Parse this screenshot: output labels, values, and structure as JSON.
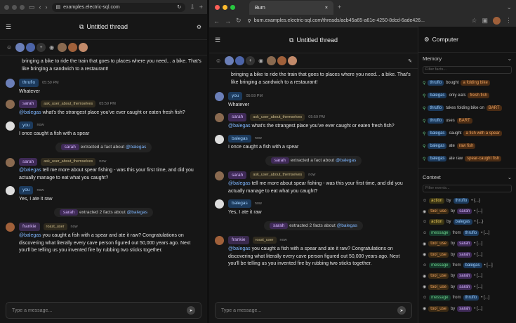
{
  "left_browser": {
    "url": "examples.electric-sql.com",
    "nav": [
      "sidebar-icon",
      "back-icon",
      "forward-icon"
    ]
  },
  "right_browser": {
    "tab_title": "Burn",
    "url": "burn.examples.electric-sql.com/threads/acb45a65-a61e-4250-8dcd-6ade426..."
  },
  "thread": {
    "title": "Untitled thread",
    "input_placeholder": "Type a message..."
  },
  "messages": {
    "intro": "bringing a bike to ride the train that goes to places where you need... a bike. That's like bringing a sandwich to a restaurant!",
    "m1": {
      "name": "thruflo",
      "time": "05:59 PM",
      "text": "Whatever"
    },
    "m2": {
      "name": "sarah",
      "role": "ask_user_about_themselves",
      "time": "05:59 PM",
      "mention": "@balegas",
      "text": " what's the strangest place you've ever caught or eaten fresh fish?"
    },
    "m3": {
      "name": "you",
      "time": "now",
      "text": "I once caught a fish with a spear"
    },
    "m3r": {
      "name": "balegas",
      "time": "now"
    },
    "s1": {
      "name": "sarah",
      "text": "extracted a fact about",
      "mention": "@balegas"
    },
    "m4": {
      "name": "sarah",
      "role": "ask_user_about_themselves",
      "time": "now",
      "mention": "@balegas",
      "text": " tell me more about spear fishing - was this your first time, and did you actually manage to eat what you caught?"
    },
    "m5": {
      "name": "you",
      "time": "now",
      "text": "Yes, I ate it raw"
    },
    "m5r": {
      "name": "balegas",
      "time": "now"
    },
    "s2": {
      "name": "sarah",
      "text": "extracted 2 facts about",
      "mention": "@balegas"
    },
    "m6": {
      "name": "frankie",
      "role": "roast_user",
      "time": "now",
      "mention": "@balegas",
      "text": " you caught a fish with a spear and ate it raw? Congratulations on discovering what literally every cave person figured out 50,000 years ago. Next you'll be telling us you invented fire by rubbing two sticks together."
    }
  },
  "computer": {
    "title": "Computer",
    "memory_label": "Memory",
    "filter_facts": "Filter facts...",
    "context_label": "Context",
    "filter_events": "Filter events...",
    "facts": [
      {
        "s": "thruflo",
        "v": "bought",
        "o": "a folding bike"
      },
      {
        "s": "balegas",
        "v": "only eats",
        "o": "fresh fish"
      },
      {
        "s": "thruflo",
        "v": "takes folding bike on",
        "o": "BART"
      },
      {
        "s": "thruflo",
        "v": "uses",
        "o": "BART"
      },
      {
        "s": "balegas",
        "v": "caught",
        "o": "a fish with a spear"
      },
      {
        "s": "balegas",
        "v": "ate",
        "o": "raw fish"
      },
      {
        "s": "balegas",
        "v": "ate raw",
        "o": "spear-caught fish"
      }
    ],
    "events": [
      {
        "t": "action",
        "by": "by",
        "w": "thruflo",
        "x": "• {...}",
        "k": "a"
      },
      {
        "t": "tool_use",
        "by": "by",
        "w": "sarah",
        "x": "• [...]",
        "k": "t"
      },
      {
        "t": "action",
        "by": "by",
        "w": "balegas",
        "x": "• {...}",
        "k": "a"
      },
      {
        "t": "message",
        "by": "from",
        "w": "thruflo",
        "x": "• [...]",
        "k": "m"
      },
      {
        "t": "tool_use",
        "by": "by",
        "w": "sarah",
        "x": "• [...]",
        "k": "t"
      },
      {
        "t": "tool_use",
        "by": "by",
        "w": "sarah",
        "x": "• [...]",
        "k": "t"
      },
      {
        "t": "message",
        "by": "from",
        "w": "balegas",
        "x": "• [...]",
        "k": "m"
      },
      {
        "t": "tool_use",
        "by": "by",
        "w": "sarah",
        "x": "• [...]",
        "k": "t"
      },
      {
        "t": "tool_use",
        "by": "by",
        "w": "sarah",
        "x": "• [...]",
        "k": "t"
      },
      {
        "t": "message",
        "by": "from",
        "w": "thruflo",
        "x": "• [...]",
        "k": "m"
      },
      {
        "t": "tool_use",
        "by": "by",
        "w": "sarah",
        "x": "• [...]",
        "k": "t"
      }
    ]
  }
}
